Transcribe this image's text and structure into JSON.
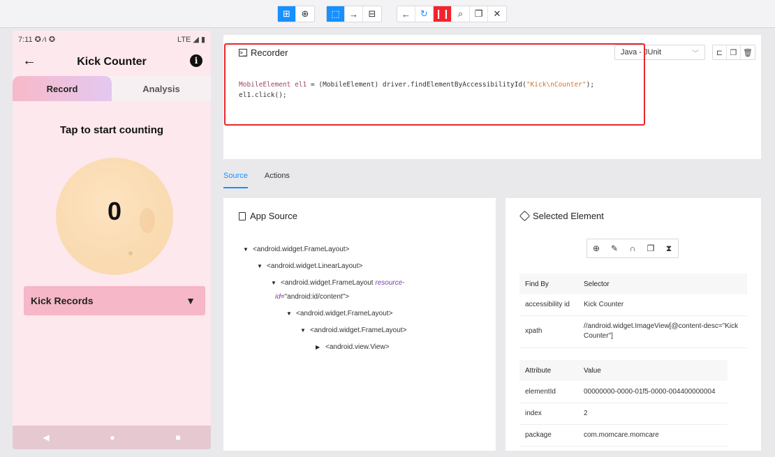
{
  "toolbar": {
    "groups": [
      [
        "grid-icon",
        "globe-icon"
      ],
      [
        "select-icon",
        "swipe-icon",
        "tap-icon"
      ],
      [
        "back-icon",
        "refresh-icon",
        "pause-icon",
        "search-icon",
        "copy-icon",
        "close-icon"
      ]
    ]
  },
  "phone": {
    "status_time": "7:11",
    "status_icons": "✪ ⁄ı ✪",
    "status_right": "LTE ◢ ▮",
    "title": "Kick Counter",
    "tabs": [
      "Record",
      "Analysis"
    ],
    "tap_label": "Tap to start counting",
    "counter": "0",
    "kick_records": "Kick Records"
  },
  "recorder": {
    "title": "Recorder",
    "language": "Java - JUnit",
    "code_line1_decl": "MobileElement el1",
    "code_line1_mid": " = (MobileElement) driver.findElementByAccessibilityId(",
    "code_line1_str": "\"Kick\\nCounter\"",
    "code_line1_end": ");",
    "code_line2": "el1.click();"
  },
  "tabs": [
    "Source",
    "Actions"
  ],
  "source": {
    "title": "App Source",
    "nodes": [
      "<android.widget.FrameLayout>",
      "<android.widget.LinearLayout>",
      "<android.widget.FrameLayout",
      "resource-",
      "id",
      "=\"android:id/content\">",
      "<android.widget.FrameLayout>",
      "<android.widget.FrameLayout>",
      "<android.view.View>"
    ]
  },
  "selected": {
    "title": "Selected Element",
    "findby_headers": [
      "Find By",
      "Selector"
    ],
    "findby_rows": [
      [
        "accessibility id",
        "Kick Counter"
      ],
      [
        "xpath",
        "//android.widget.ImageView[@content-desc=\"Kick Counter\"]"
      ]
    ],
    "attr_headers": [
      "Attribute",
      "Value"
    ],
    "attr_rows": [
      [
        "elementId",
        "00000000-0000-01f5-0000-004400000004"
      ],
      [
        "index",
        "2"
      ],
      [
        "package",
        "com.momcare.momcare"
      ]
    ]
  }
}
